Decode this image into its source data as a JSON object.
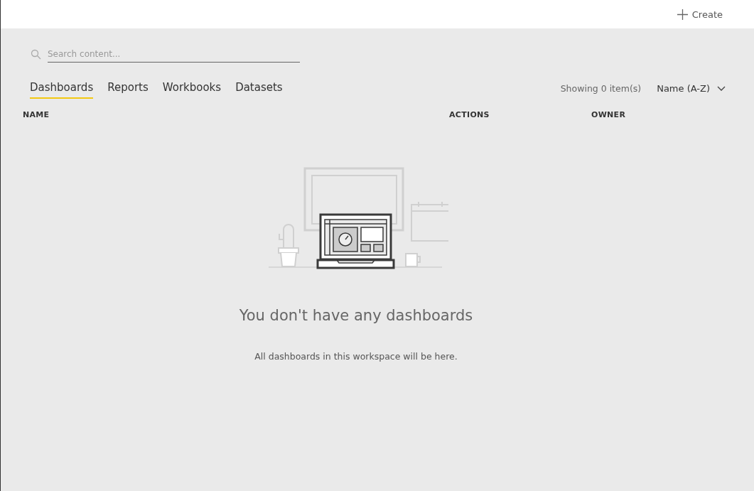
{
  "top_bar": {
    "create_label": "Create"
  },
  "search": {
    "placeholder": "Search content..."
  },
  "tabs": [
    {
      "label": "Dashboards",
      "selected": true
    },
    {
      "label": "Reports",
      "selected": false
    },
    {
      "label": "Workbooks",
      "selected": false
    },
    {
      "label": "Datasets",
      "selected": false
    }
  ],
  "item_count": "Showing 0 item(s)",
  "sort": {
    "value": "Name (A-Z)"
  },
  "table": {
    "columns": [
      "NAME",
      "ACTIONS",
      "OWNER"
    ]
  },
  "empty_state": {
    "title": "You don't have any dashboards",
    "message": "All dashboards in this workspace will be here."
  }
}
